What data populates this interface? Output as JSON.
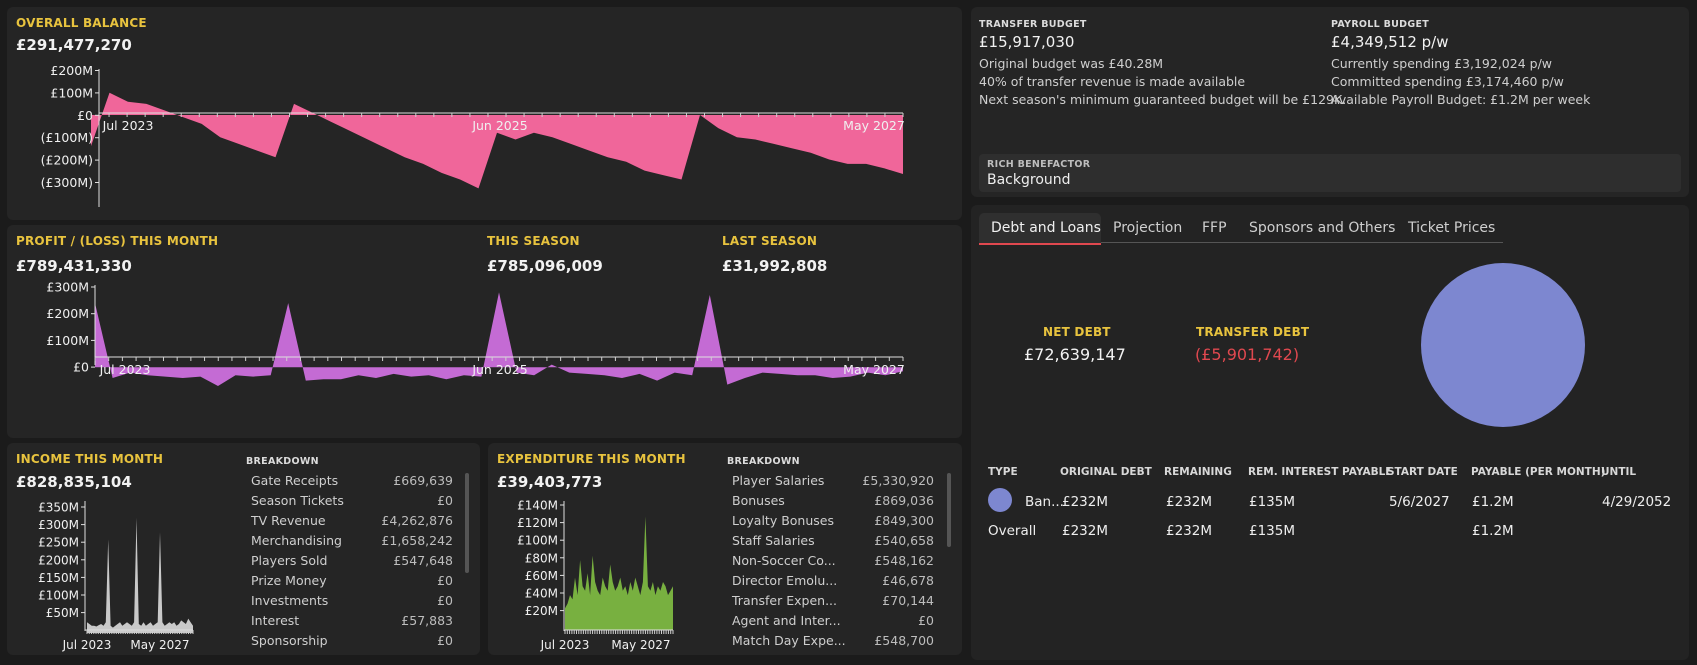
{
  "overall_balance": {
    "label": "OVERALL BALANCE",
    "value": "£291,477,270",
    "chart_data": {
      "type": "area",
      "y_ticks": [
        "£200M",
        "£100M",
        "£0",
        "(£100M)",
        "(£200M)",
        "(£300M)"
      ],
      "x_ticks": [
        "Jul 2023",
        "Jun 2025",
        "May 2027"
      ],
      "ylim": [
        -400,
        200
      ],
      "color": "#f0669a",
      "values": [
        -140,
        100,
        60,
        50,
        20,
        -10,
        -40,
        -100,
        -130,
        -160,
        -190,
        50,
        10,
        -30,
        -70,
        -110,
        -150,
        -190,
        -220,
        -260,
        -290,
        -330,
        -80,
        -110,
        -80,
        -100,
        -130,
        -160,
        -190,
        -210,
        -250,
        -270,
        -290,
        0,
        -60,
        -100,
        -110,
        -130,
        -150,
        -170,
        -200,
        -220,
        -220,
        -240,
        -265
      ]
    }
  },
  "profit": {
    "label": "PROFIT / (LOSS) THIS MONTH",
    "value": "£789,431,330",
    "season_label": "THIS SEASON",
    "season_value": "£785,096,009",
    "last_label": "LAST SEASON",
    "last_value": "£31,992,808",
    "chart_data": {
      "type": "area",
      "y_ticks": [
        "£300M",
        "£200M",
        "£100M",
        "£0"
      ],
      "x_ticks": [
        "Jul 2023",
        "Jun 2025",
        "May 2027"
      ],
      "ylim": [
        -100,
        300
      ],
      "color": "#c46bd4",
      "values": [
        240,
        -40,
        -20,
        -30,
        -35,
        -40,
        -35,
        -70,
        -30,
        -35,
        -30,
        240,
        -50,
        -45,
        -45,
        -30,
        -40,
        -25,
        -35,
        -30,
        -45,
        -30,
        -35,
        280,
        -20,
        -30,
        10,
        -20,
        -25,
        -30,
        -40,
        -25,
        -50,
        -20,
        -30,
        270,
        -65,
        -40,
        -20,
        -25,
        -30,
        -30,
        -40,
        -35,
        -20,
        -30,
        -15
      ]
    }
  },
  "income": {
    "label": "INCOME THIS MONTH",
    "value": "£828,835,104",
    "breakdown_label": "BREAKDOWN",
    "chart_data": {
      "type": "area",
      "y_ticks": [
        "£350M",
        "£300M",
        "£250M",
        "£200M",
        "£150M",
        "£100M",
        "£50M"
      ],
      "x_ticks": [
        "Jul 2023",
        "May 2027"
      ],
      "ylim": [
        0,
        350
      ],
      "color": "#c9c9c9",
      "values": [
        30,
        25,
        20,
        20,
        18,
        22,
        25,
        20,
        30,
        260,
        20,
        15,
        20,
        25,
        30,
        20,
        25,
        30,
        25,
        20,
        30,
        320,
        25,
        20,
        30,
        20,
        25,
        30,
        20,
        25,
        30,
        280,
        30,
        20,
        25,
        30,
        25,
        30,
        20,
        25,
        35,
        30,
        25,
        40,
        30,
        20
      ]
    },
    "items": [
      {
        "name": "Gate Receipts",
        "value": "£669,639"
      },
      {
        "name": "Season Tickets",
        "value": "£0"
      },
      {
        "name": "TV Revenue",
        "value": "£4,262,876"
      },
      {
        "name": "Merchandising",
        "value": "£1,658,242"
      },
      {
        "name": "Players Sold",
        "value": "£547,648"
      },
      {
        "name": "Prize Money",
        "value": "£0"
      },
      {
        "name": "Investments",
        "value": "£0"
      },
      {
        "name": "Interest",
        "value": "£57,883"
      },
      {
        "name": "Sponsorship",
        "value": "£0"
      }
    ]
  },
  "expenditure": {
    "label": "EXPENDITURE THIS MONTH",
    "value": "£39,403,773",
    "breakdown_label": "BREAKDOWN",
    "chart_data": {
      "type": "area",
      "y_ticks": [
        "£140M",
        "£120M",
        "£100M",
        "£80M",
        "£60M",
        "£40M",
        "£20M"
      ],
      "x_ticks": [
        "Jul 2023",
        "May 2027"
      ],
      "ylim": [
        0,
        150
      ],
      "color": "#78b040",
      "values": [
        25,
        30,
        40,
        35,
        60,
        40,
        80,
        50,
        45,
        65,
        40,
        85,
        55,
        45,
        40,
        60,
        50,
        45,
        75,
        55,
        45,
        50,
        60,
        45,
        50,
        40,
        55,
        45,
        60,
        50,
        40,
        55,
        130,
        50,
        45,
        55,
        40,
        50,
        45,
        55,
        50,
        40,
        45,
        50
      ]
    },
    "items": [
      {
        "name": "Player Salaries",
        "value": "£5,330,920"
      },
      {
        "name": "Bonuses",
        "value": "£869,036"
      },
      {
        "name": "Loyalty Bonuses",
        "value": "£849,300"
      },
      {
        "name": "Staff Salaries",
        "value": "£540,658"
      },
      {
        "name": "Non-Soccer Co...",
        "value": "£548,162"
      },
      {
        "name": "Director Emolu...",
        "value": "£46,678"
      },
      {
        "name": "Transfer Expen...",
        "value": "£70,144"
      },
      {
        "name": "Agent and Inter...",
        "value": "£0"
      },
      {
        "name": "Match Day Expe...",
        "value": "£548,700"
      }
    ]
  },
  "transfer_budget": {
    "label": "TRANSFER BUDGET",
    "value": "£15,917,030",
    "lines": [
      "Original budget was £40.28M",
      "40% of transfer revenue is made available",
      "Next season's minimum guaranteed budget will be £129K."
    ]
  },
  "payroll_budget": {
    "label": "PAYROLL BUDGET",
    "value": "£4,349,512 p/w",
    "lines": [
      "Currently spending £3,192,024 p/w",
      "Committed spending £3,174,460 p/w",
      "Available Payroll Budget: £1.2M per week"
    ]
  },
  "benefactor": {
    "label": "RICH BENEFACTOR",
    "value": "Background"
  },
  "tabs": [
    "Debt and Loans",
    "Projection",
    "FFP",
    "Sponsors and Others",
    "Ticket Prices"
  ],
  "active_tab": "Debt and Loans",
  "debt": {
    "net_label": "NET DEBT",
    "net_value": "£72,639,147",
    "transfer_label": "TRANSFER DEBT",
    "transfer_value": "(£5,901,742)",
    "pie_color": "#7d87d0",
    "negative_color": "#e0484f",
    "chart_data": {
      "type": "pie",
      "categories": [
        "Ban..."
      ],
      "values": [
        100
      ]
    }
  },
  "loans_table": {
    "headers": [
      "TYPE",
      "ORIGINAL DEBT",
      "REMAINING",
      "REM. INTEREST PAYABLE",
      "START DATE",
      "PAYABLE (PER MONTH)",
      "UNTIL"
    ],
    "rows": [
      {
        "type": "Ban...",
        "original": "£232M",
        "remaining": "£232M",
        "interest": "£135M",
        "start": "5/6/2027",
        "payable": "£1.2M",
        "until": "4/29/2052"
      }
    ],
    "total": {
      "type": "Overall",
      "original": "£232M",
      "remaining": "£232M",
      "interest": "£135M",
      "start": "",
      "payable": "£1.2M",
      "until": ""
    }
  }
}
